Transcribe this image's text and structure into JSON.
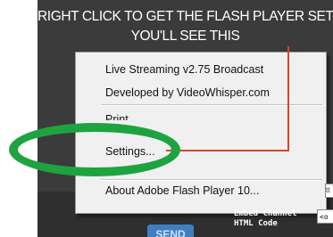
{
  "instruction": {
    "line1": "RIGHT CLICK TO GET THE FLASH PLAYER SETTINGS",
    "line2": "YOU'LL SEE THIS"
  },
  "context_menu": {
    "items": [
      {
        "label": "Live Streaming v2.75 Broadcast"
      },
      {
        "label": "Developed by VideoWhisper.com"
      },
      {
        "label": "Print..."
      },
      {
        "label": "Settings..."
      },
      {
        "label": "About Adobe Flash Player 10..."
      }
    ]
  },
  "embed": {
    "label_line1": "Embed Channel",
    "label_line2": "HTML Code",
    "value": "<o"
  },
  "right_field": {
    "value": "tt"
  },
  "send_button": {
    "label": "SEND"
  },
  "colors": {
    "highlight_ellipse": "#1ea341",
    "pointer_line": "#d9442b",
    "app_background": "#3b3b3b"
  }
}
